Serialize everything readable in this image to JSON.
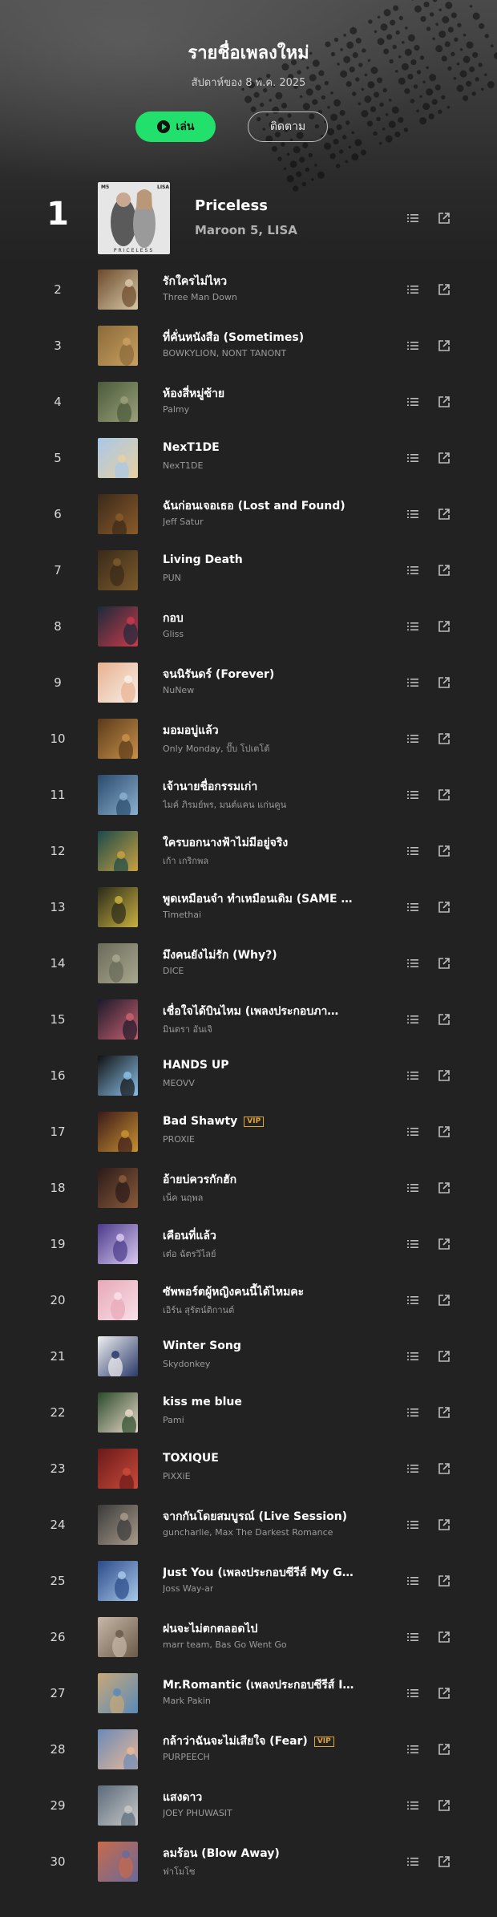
{
  "header": {
    "title": "รายชื่อเพลงใหม่",
    "updated": "สัปดาห์ของ 8 พ.ค. 2025",
    "play_label": "เล่น",
    "follow_label": "ติดตาม",
    "accent_color": "#21e06b"
  },
  "first_cover": {
    "top_left": "M5",
    "top_right": "LISA",
    "bottom": "PRICELESS"
  },
  "tracks": [
    {
      "rank": "1",
      "title": "Priceless",
      "artist": "Maroon 5, LISA",
      "vip": false,
      "colors": [
        "#dcdcdc",
        "#8a8a8a"
      ]
    },
    {
      "rank": "2",
      "title": "รักใครไม่ไหว",
      "artist": "Three Man Down",
      "vip": false,
      "colors": [
        "#6b4a2a",
        "#d8c8a8"
      ]
    },
    {
      "rank": "3",
      "title": "ที่คั่นหนังสือ (Sometimes)",
      "artist": "BOWKYLION, NONT TANONT",
      "vip": false,
      "colors": [
        "#8a6a3a",
        "#c9a060"
      ]
    },
    {
      "rank": "4",
      "title": "ห้องสี่หมู่ซ้าย",
      "artist": "Palmy",
      "vip": false,
      "colors": [
        "#4a5a3a",
        "#9aa07a"
      ]
    },
    {
      "rank": "5",
      "title": "NexT1DE",
      "artist": "NexT1DE",
      "vip": false,
      "colors": [
        "#a8c8e8",
        "#e8d0a0"
      ]
    },
    {
      "rank": "6",
      "title": "ฉันก่อนเจอเธอ (Lost and Found)",
      "artist": "Jeff Satur",
      "vip": false,
      "colors": [
        "#3a2a1a",
        "#8a5a2a"
      ]
    },
    {
      "rank": "7",
      "title": "Living Death",
      "artist": "PUN",
      "vip": false,
      "colors": [
        "#3a2a1a",
        "#7a5a2a"
      ]
    },
    {
      "rank": "8",
      "title": "กอบ",
      "artist": "Gliss",
      "vip": false,
      "colors": [
        "#1a2a3a",
        "#c83a4a"
      ]
    },
    {
      "rank": "9",
      "title": "จนนิรันดร์ (Forever)",
      "artist": "NuNew",
      "vip": false,
      "colors": [
        "#e8b090",
        "#f8f0e8"
      ]
    },
    {
      "rank": "10",
      "title": "มอมอบู่แล้ว",
      "artist": "Only Monday, ปั๊บ โปเตโต้",
      "vip": false,
      "colors": [
        "#5a3a1a",
        "#c8904a"
      ]
    },
    {
      "rank": "11",
      "title": "เจ้านายชื่อกรรมเก่า",
      "artist": "ไมค์ ภิรมย์พร, มนต์แคน แก่นคูน",
      "vip": false,
      "colors": [
        "#2a4a6a",
        "#8ab0d0"
      ]
    },
    {
      "rank": "12",
      "title": "ใครบอกนางฟ้าไม่มีอยู่จริง",
      "artist": "เก้า เกริกพล",
      "vip": false,
      "colors": [
        "#1a4a4a",
        "#c8a040"
      ]
    },
    {
      "rank": "13",
      "title": "พูดเหมือนจำ ทำเหมือนเดิม (SAME …",
      "artist": "Timethai",
      "vip": false,
      "colors": [
        "#2a2a1a",
        "#c8b040"
      ]
    },
    {
      "rank": "14",
      "title": "มึงคนยังไม่รัก (Why?)",
      "artist": "DICE",
      "vip": false,
      "colors": [
        "#6a6a5a",
        "#a8a890"
      ]
    },
    {
      "rank": "15",
      "title": "เชื่อใจได้บินไหม (เพลงประกอบภา…",
      "artist": "มินตรา อันเจิ",
      "vip": false,
      "colors": [
        "#1a1a2a",
        "#c86070"
      ]
    },
    {
      "rank": "16",
      "title": "HANDS UP",
      "artist": "MEOVV",
      "vip": false,
      "colors": [
        "#111111",
        "#8ac0e8"
      ]
    },
    {
      "rank": "17",
      "title": "Bad Shawty",
      "artist": "PROXIE",
      "vip": true,
      "colors": [
        "#3a1a1a",
        "#c89030"
      ]
    },
    {
      "rank": "18",
      "title": "อ้ายบ่ควรกักฮัก",
      "artist": "เน็ค นฤพล",
      "vip": false,
      "colors": [
        "#2a1a1a",
        "#8a5a3a"
      ]
    },
    {
      "rank": "19",
      "title": "เคือนที่แล้ว",
      "artist": "เต๋อ ฉัตรวิไลย์",
      "vip": false,
      "colors": [
        "#4a3a8a",
        "#d8c8f0"
      ]
    },
    {
      "rank": "20",
      "title": "ซัพพอร์ตผู้หญิงคนนี้ได้ไหมคะ",
      "artist": "เอิร์น สุรัตน์ติกานต์",
      "vip": false,
      "colors": [
        "#e8a8b8",
        "#f8e0e8"
      ]
    },
    {
      "rank": "21",
      "title": "Winter Song",
      "artist": "Skydonkey",
      "vip": false,
      "colors": [
        "#f0f0f0",
        "#2a3a6a"
      ]
    },
    {
      "rank": "22",
      "title": "kiss me blue",
      "artist": "Pami",
      "vip": false,
      "colors": [
        "#2a4a2a",
        "#e8d8c8"
      ]
    },
    {
      "rank": "23",
      "title": "TOXIQUE",
      "artist": "PiXXiE",
      "vip": false,
      "colors": [
        "#6a1a1a",
        "#c84a3a"
      ]
    },
    {
      "rank": "24",
      "title": "จากกันโดยสมบูรณ์ (Live Session)",
      "artist": "guncharlie, Max The Darkest Romance",
      "vip": false,
      "colors": [
        "#3a3a3a",
        "#a89a8a"
      ]
    },
    {
      "rank": "25",
      "title": "Just You (เพลงประกอบซีรีส์ My G…",
      "artist": "Joss Way-ar",
      "vip": false,
      "colors": [
        "#2a4a8a",
        "#a8c8e8"
      ]
    },
    {
      "rank": "26",
      "title": "ฝนจะไม่ตกตลอดไป",
      "artist": "marr team, Bas Go Went Go",
      "vip": false,
      "colors": [
        "#c8b8a8",
        "#6a5a4a"
      ]
    },
    {
      "rank": "27",
      "title": "Mr.Romantic (เพลงประกอบซีรีส์ I…",
      "artist": "Mark Pakin",
      "vip": false,
      "colors": [
        "#c8a878",
        "#5a8ab8"
      ]
    },
    {
      "rank": "28",
      "title": "กล้าว่าฉันจะไม่เสียใจ (Fear)",
      "artist": "PURPEECH",
      "vip": true,
      "colors": [
        "#6a8ab8",
        "#e8b898"
      ]
    },
    {
      "rank": "29",
      "title": "แสงดาว",
      "artist": "JOEY PHUWASIT",
      "vip": false,
      "colors": [
        "#5a6a7a",
        "#c8c8c8"
      ]
    },
    {
      "rank": "30",
      "title": "ลมร้อน (Blow Away)",
      "artist": "ฟาโมโซ",
      "vip": false,
      "colors": [
        "#c86a4a",
        "#6a6a9a"
      ]
    }
  ],
  "vip_label": "VIP",
  "icons": {
    "add_to_queue": "queue-list-icon",
    "share": "external-share-icon",
    "play": "play-circle-icon"
  }
}
